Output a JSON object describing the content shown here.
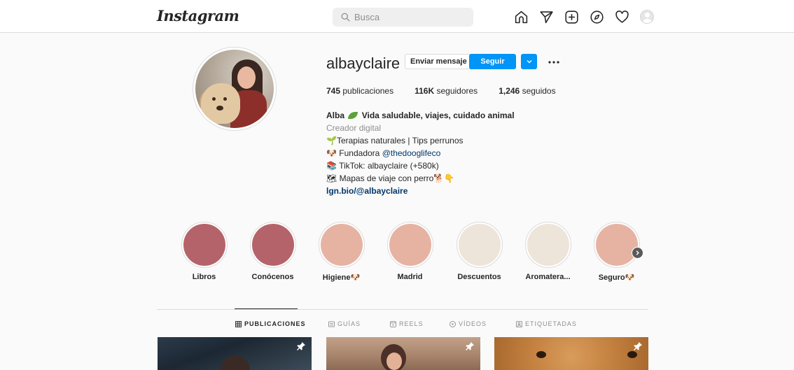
{
  "nav": {
    "logo": "Instagram",
    "search_placeholder": "Busca"
  },
  "profile": {
    "username": "albayclaire",
    "message_button": "Enviar mensaje",
    "follow_button": "Seguir",
    "stats": {
      "posts_count": "745",
      "posts_label": "publicaciones",
      "followers_count": "116K",
      "followers_label": "seguidores",
      "following_count": "1,246",
      "following_label": "seguidos"
    },
    "bio": {
      "name_pre": "Alba",
      "name_post": "Vida saludable, viajes, cuidado animal",
      "category": "Creador digital",
      "line1": "Terapias naturales | Tips perrunos",
      "line1_emoji": "🌱",
      "line2_pre": "Fundadora ",
      "line2_mention": "@thedooglifeco",
      "line2_emoji": "🐶",
      "line3": "TikTok: albayclaire (+580k)",
      "line3_emoji": "📚",
      "line4": "Mapas de viaje con perro",
      "line4_emoji_pre": "🗺",
      "line4_emoji_post": "🐕👇",
      "link": "lgn.bio/@albayclaire"
    }
  },
  "highlights": [
    {
      "label": "Libros",
      "color": "#b5636a"
    },
    {
      "label": "Conócenos",
      "color": "#b5636a"
    },
    {
      "label": "Higiene",
      "emoji": "🐶",
      "color": "#e6b3a3"
    },
    {
      "label": "Madrid",
      "color": "#e6b3a3"
    },
    {
      "label": "Descuentos",
      "color": "#ede4da"
    },
    {
      "label": "Aromatera...",
      "color": "#ede4da"
    },
    {
      "label": "Seguro",
      "emoji": "🐶",
      "color": "#e6b3a3"
    }
  ],
  "tabs": [
    {
      "label": "PUBLICACIONES",
      "icon": "grid-icon"
    },
    {
      "label": "GUÍAS",
      "icon": "guides-icon"
    },
    {
      "label": "REELS",
      "icon": "reels-icon"
    },
    {
      "label": "VÍDEOS",
      "icon": "video-icon"
    },
    {
      "label": "ETIQUETADAS",
      "icon": "tagged-icon"
    }
  ]
}
